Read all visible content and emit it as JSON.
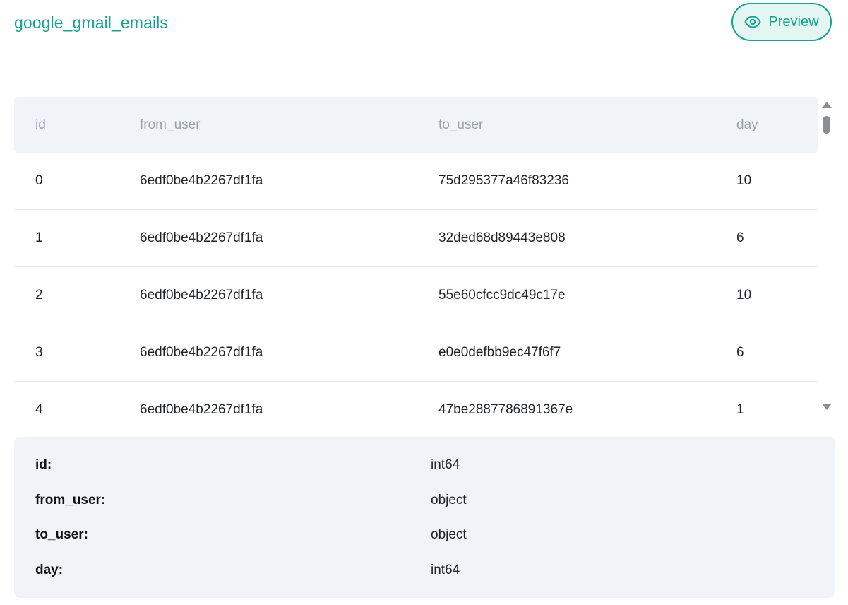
{
  "title": "google_gmail_emails",
  "preview_button": {
    "label": "Preview",
    "icon": "eye-icon"
  },
  "table": {
    "columns": [
      "id",
      "from_user",
      "to_user",
      "day"
    ],
    "rows": [
      [
        "0",
        "6edf0be4b2267df1fa",
        "75d295377a46f83236",
        "10"
      ],
      [
        "1",
        "6edf0be4b2267df1fa",
        "32ded68d89443e808",
        "6"
      ],
      [
        "2",
        "6edf0be4b2267df1fa",
        "55e60cfcc9dc49c17e",
        "10"
      ],
      [
        "3",
        "6edf0be4b2267df1fa",
        "e0e0defbb9ec47f6f7",
        "6"
      ],
      [
        "4",
        "6edf0be4b2267df1fa",
        "47be2887786891367e",
        "1"
      ]
    ]
  },
  "schema": [
    {
      "name": "id:",
      "type": "int64"
    },
    {
      "name": "from_user:",
      "type": "object"
    },
    {
      "name": "to_user:",
      "type": "object"
    },
    {
      "name": "day:",
      "type": "int64"
    }
  ],
  "colors": {
    "accent": "#15a390",
    "accent_bg": "#e3f6f2",
    "panel_bg": "#f0f3f7",
    "header_text": "#9aa1ad"
  }
}
